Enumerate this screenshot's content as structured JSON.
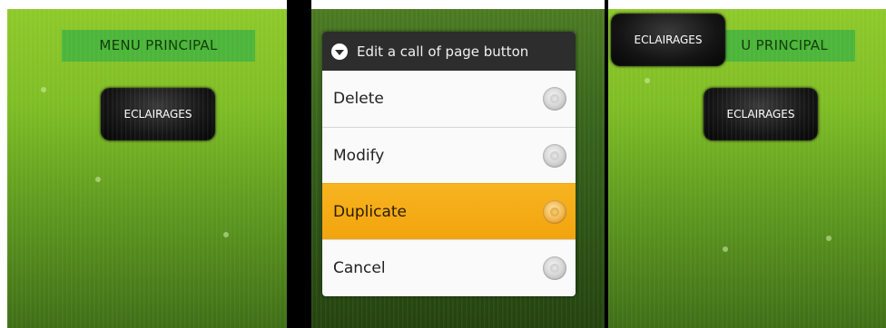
{
  "panels": {
    "left": {
      "menu_title": "MENU PRINCIPAL",
      "button_label": "ECLAIRAGES"
    },
    "middle": {
      "dialog": {
        "title": "Edit a call of page button",
        "options": [
          "Delete",
          "Modify",
          "Duplicate",
          "Cancel"
        ],
        "selected": "Duplicate"
      }
    },
    "right": {
      "menu_title_partial": "U PRINCIPAL",
      "dragged_button_label": "ECLAIRAGES",
      "button_label": "ECLAIRAGES"
    }
  },
  "colors": {
    "background_green": "#7fbd25",
    "menu_title_bg": "#4cb53a",
    "button_bg": "#141414",
    "dialog_header": "#2d2d2d",
    "selection_orange": "#f2a40d"
  },
  "icons": {
    "dialog_header": "chevron-down-circle-icon",
    "option_control": "radio-button-icon"
  }
}
